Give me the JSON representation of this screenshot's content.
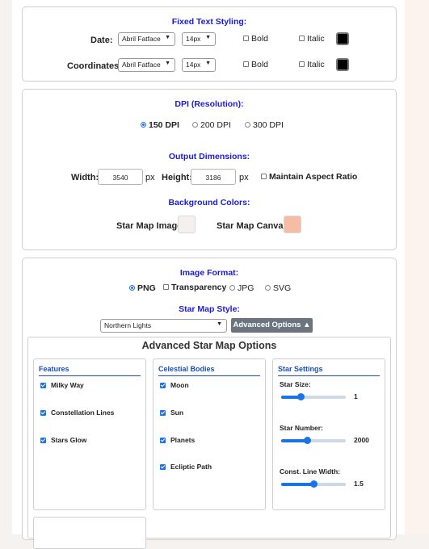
{
  "text_styling": {
    "title": "Fixed Text Styling:",
    "rows": [
      {
        "label": "Date:",
        "font": "Abril Fatface",
        "size": "14px",
        "bold": "Bold",
        "italic": "Italic",
        "color": "#000000"
      },
      {
        "label": "Coordinates:",
        "font": "Abril Fatface",
        "size": "14px",
        "bold": "Bold",
        "italic": "Italic",
        "color": "#000000"
      }
    ]
  },
  "resolution": {
    "dpi_title": "DPI (Resolution):",
    "dpi_options": [
      "150 DPI",
      "200 DPI",
      "300 DPI"
    ],
    "dpi_selected": "150 DPI",
    "dims_title": "Output Dimensions:",
    "width_label": "Width:",
    "width_value": "3540",
    "height_label": "Height:",
    "height_value": "3186",
    "unit": "px",
    "aspect_label": "Maintain Aspect Ratio",
    "bg_title": "Background Colors:",
    "bg_image_label": "Star Map Image:",
    "bg_image_color": "#f5f0ee",
    "bg_canvas_label": "Star Map Canvas:",
    "bg_canvas_color": "#f7bca4"
  },
  "format": {
    "title": "Image Format:",
    "png": "PNG",
    "transparency": "Transparency",
    "jpg": "JPG",
    "svg": "SVG",
    "selected": "PNG",
    "style_title": "Star Map Style:",
    "style_value": "Northern Lights",
    "advanced_button": "Advanced Options ▲"
  },
  "advanced": {
    "title": "Advanced Star Map Options",
    "features": {
      "title": "Features",
      "items": [
        "Milky Way",
        "Constellation Lines",
        "Stars Glow"
      ]
    },
    "celestial": {
      "title": "Celestial Bodies",
      "items": [
        "Moon",
        "Sun",
        "Planets",
        "Ecliptic Path"
      ]
    },
    "settings": {
      "title": "Star Settings",
      "sliders": [
        {
          "label": "Star Size:",
          "value": "1",
          "fraction": 0.3
        },
        {
          "label": "Star Number:",
          "value": "2000",
          "fraction": 0.4
        },
        {
          "label": "Const. Line Width:",
          "value": "1.5",
          "fraction": 0.5
        }
      ]
    }
  },
  "colors": {
    "accent": "#1a73e8",
    "title_blue": "#1a1adb",
    "button_gray": "#6c757d"
  }
}
